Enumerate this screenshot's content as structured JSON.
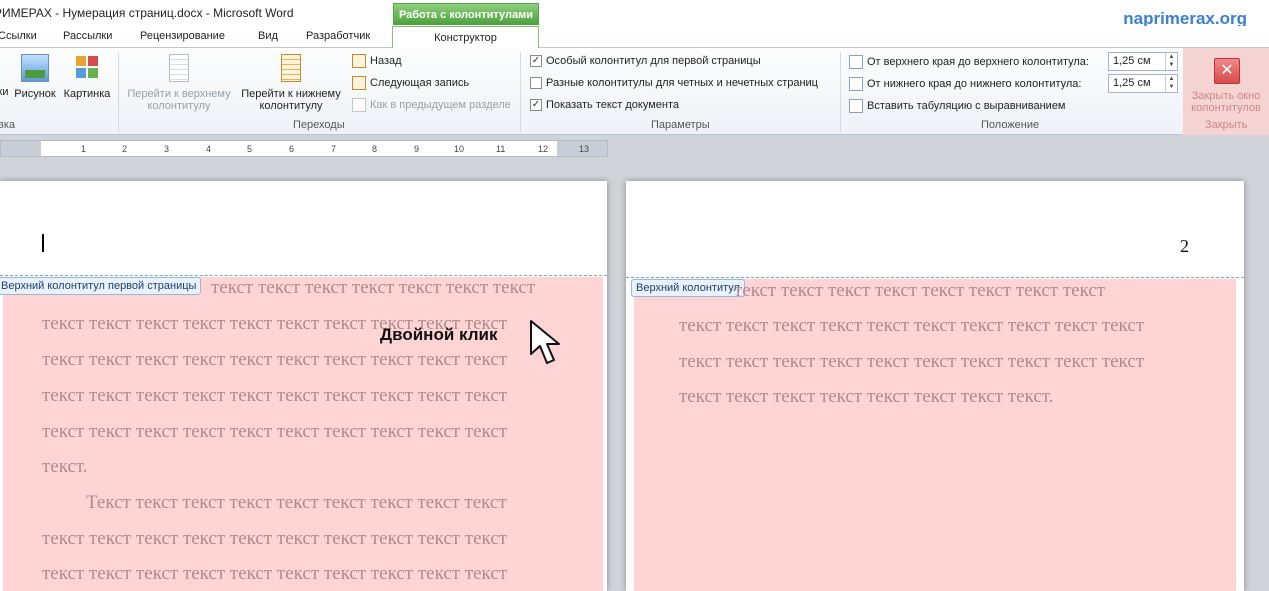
{
  "window": {
    "title": "РИМЕРАХ - Нумерация страниц.docx  -  Microsoft Word",
    "brand": "naprimerax.org",
    "context_group": "Работа с колонтитулами"
  },
  "tabs": [
    "Ссылки",
    "Рассылки",
    "Рецензирование",
    "Вид",
    "Разработчик"
  ],
  "active_tab": "Конструктор",
  "ribbon": {
    "insert_group": {
      "label": "вка",
      "buttons": [
        "ки",
        "Рисунок",
        "Картинка"
      ]
    },
    "navigation": {
      "label": "Переходы",
      "go_header_l1": "Перейти к верхнему",
      "go_header_l2": "колонтитулу",
      "go_footer_l1": "Перейти к нижнему",
      "go_footer_l2": "колонтитулу",
      "back": "Назад",
      "next": "Следующая запись",
      "link_prev": "Как в предыдущем разделе"
    },
    "options": {
      "label": "Параметры",
      "different_first": {
        "label": "Особый колонтитул для первой страницы",
        "checked": true
      },
      "different_odd_even": {
        "label": "Разные колонтитулы для четных и нечетных страниц",
        "checked": false
      },
      "show_text": {
        "label": "Показать текст документа",
        "checked": true
      }
    },
    "position": {
      "label": "Положение",
      "header_from_top": "От верхнего края до верхнего колонтитула:",
      "header_value": "1,25 см",
      "footer_from_bottom": "От нижнего края до нижнего колонтитула:",
      "footer_value": "1,25 см",
      "insert_tab": "Вставить табуляцию с выравниванием"
    },
    "close": {
      "label": "Закрыть",
      "button_l1": "Закрыть окно",
      "button_l2": "колонтитулов"
    }
  },
  "ruler": [
    "1",
    "2",
    "3",
    "4",
    "5",
    "6",
    "7",
    "8",
    "9",
    "10",
    "11",
    "12",
    "13"
  ],
  "page1": {
    "header_tab": "Верхний колонтитул первой страницы",
    "annotation": "Двойной клик",
    "p1_first": "текст текст текст текст текст текст текст",
    "p1_lines": [
      "текст текст текст текст текст текст текст текст текст текст",
      "текст текст текст текст текст текст текст текст текст текст",
      "текст текст текст текст текст текст текст текст текст текст",
      "текст текст текст текст текст текст текст текст текст текст"
    ],
    "p1_end": "текст.",
    "p2_lines": [
      "Текст текст текст текст текст текст текст текст текст",
      "текст текст текст текст текст текст текст текст текст текст",
      "текст текст текст текст текст текст текст текст текст текст"
    ]
  },
  "page2": {
    "header_tab": "Верхний колонтитул",
    "page_number": "2",
    "first": "текст текст текст текст текст текст текст текст",
    "lines": [
      "текст текст текст текст текст текст текст текст текст текст",
      "текст текст текст текст текст текст текст текст текст текст",
      "текст текст текст текст текст текст текст текст."
    ]
  }
}
